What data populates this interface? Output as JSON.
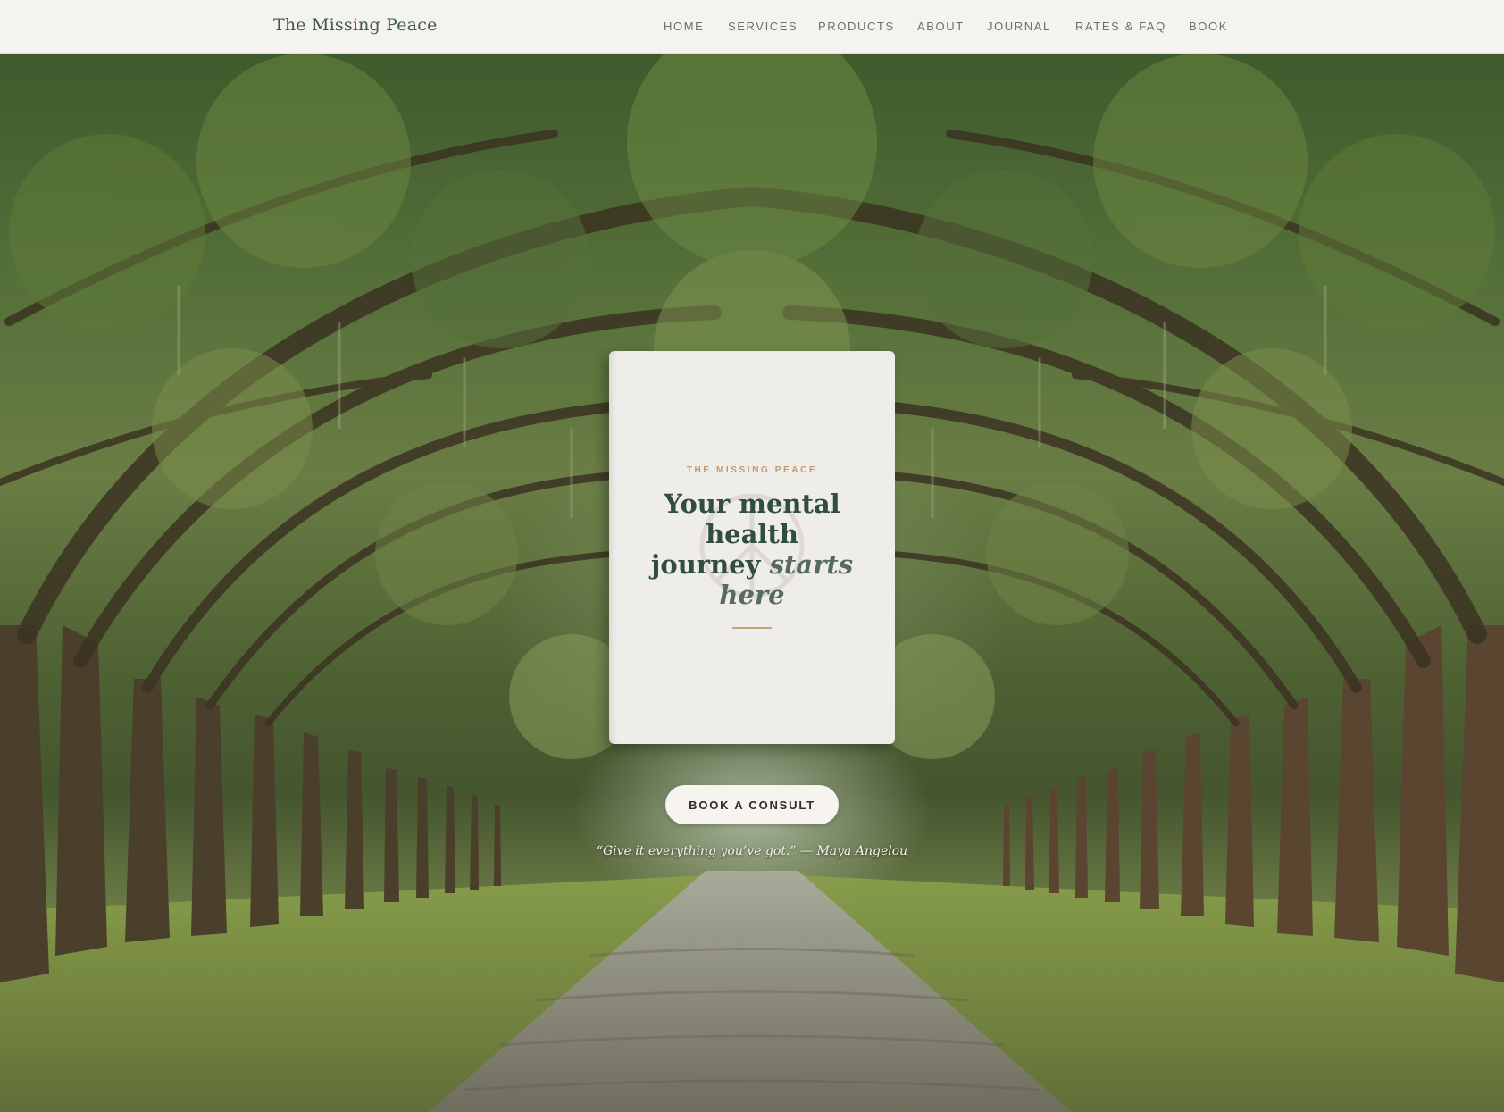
{
  "header": {
    "brand": "The Missing Peace",
    "nav": [
      {
        "label": "HOME"
      },
      {
        "label": "SERVICES"
      },
      {
        "label": "PRODUCTS"
      },
      {
        "label": "ABOUT"
      },
      {
        "label": "JOURNAL"
      },
      {
        "label": "RATES & FAQ"
      },
      {
        "label": "BOOK"
      }
    ]
  },
  "hero": {
    "card": {
      "eyebrow": "THE MISSING PEACE",
      "headline_line1": "Your mental",
      "headline_line2": "health",
      "headline_line3_plain": "journey ",
      "headline_line3_italic": "starts",
      "headline_line4_italic": "here",
      "watermark_icon": "peace-sign-icon"
    },
    "cta_label": "BOOK A CONSULT",
    "quote": "“Give it everything you’ve got.” — Maya Angelou"
  },
  "colors": {
    "brand_green": "#3c5a44",
    "accent_tan": "#c39b6a",
    "card_bg": "#efede9",
    "header_bg": "#f5f3ef"
  }
}
